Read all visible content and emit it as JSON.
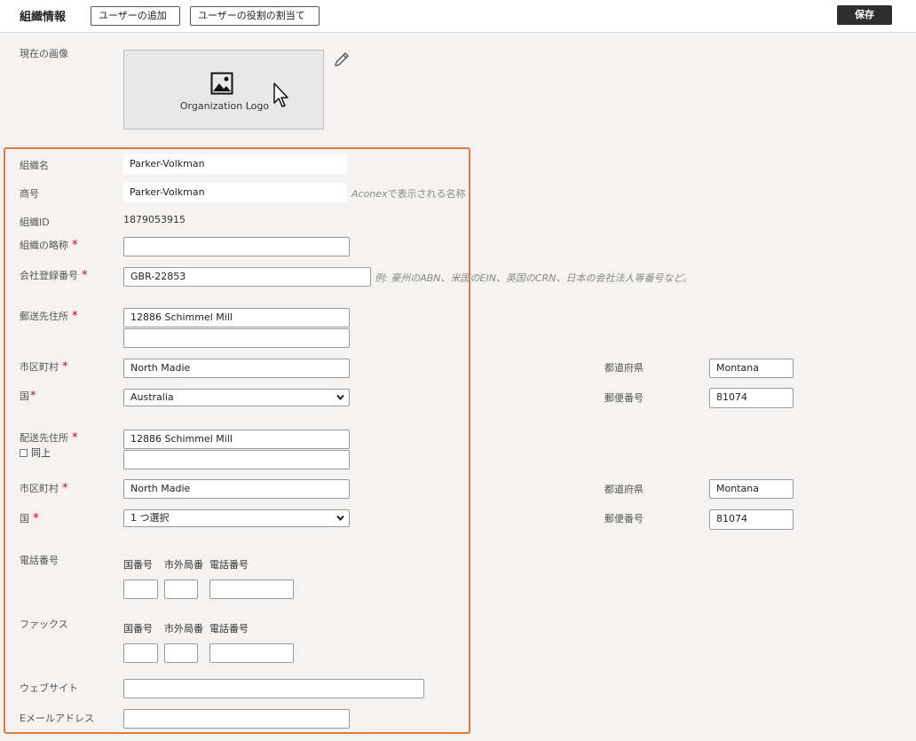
{
  "header": {
    "title": "組織情報",
    "add_user_label": "ユーザーの追加",
    "assign_role_label": "ユーザーの役割の割当て",
    "save_label": "保存"
  },
  "logo": {
    "label": "現在の画像",
    "text": "Organization Logo"
  },
  "org": {
    "name_label": "組織名",
    "name_value": "Parker-Volkman",
    "trade_label": "商号",
    "trade_value": "Parker-Volkman",
    "trade_hint_prefix": "Aconex",
    "trade_hint_suffix": "で表示される名称",
    "id_label": "組織ID",
    "id_value": "1879053915",
    "abbr_label": "組織の略称",
    "abbr_value": "",
    "reg_label": "会社登録番号",
    "reg_value": "GBR-22853",
    "reg_hint": "例: 豪州のABN、米国のEIN、英国のCRN、日本の会社法人等番号など。"
  },
  "postal": {
    "label": "郵送先住所",
    "line1": "12886 Schimmel Mill",
    "line2": "",
    "city_label": "市区町村",
    "city_value": "North Madie",
    "state_label": "都道府県",
    "state_value": "Montana",
    "country_label": "国",
    "country_value": "Australia",
    "zip_label": "郵便番号",
    "zip_value": "81074"
  },
  "delivery": {
    "label": "配送先住所",
    "same_label": "同上",
    "line1": "12886 Schimmel Mill",
    "line2": "",
    "city_label": "市区町村",
    "city_value": "North Madie",
    "state_label": "都道府県",
    "state_value": "Montana",
    "country_label": "国",
    "country_value": "1 つ選択",
    "zip_label": "郵便番号",
    "zip_value": "81074"
  },
  "phone": {
    "label": "電話番号",
    "country_code_label": "国番号",
    "area_code_label": "市外局番",
    "number_label": "電話番号"
  },
  "fax": {
    "label": "ファックス",
    "country_code_label": "国番号",
    "area_code_label": "市外局番",
    "number_label": "電話番号"
  },
  "contact": {
    "website_label": "ウェブサイト",
    "email_label": "Eメールアドレス"
  },
  "colors": {
    "accent_outline": "#e07b39",
    "required": "#d0021b",
    "save_bg": "#2d2d2d"
  }
}
